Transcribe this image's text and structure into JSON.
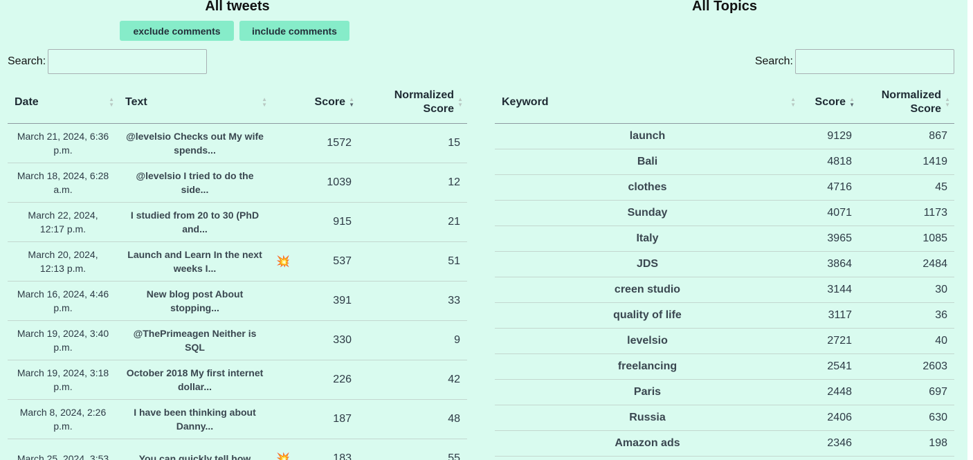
{
  "left": {
    "title": "All tweets",
    "buttons": {
      "exclude": "exclude comments",
      "include": "include comments"
    },
    "search_label": "Search:",
    "columns": {
      "date": "Date",
      "text": "Text",
      "score": "Score",
      "norm1": "Normalized",
      "norm2": "Score"
    },
    "rows": [
      {
        "date": "March 21, 2024, 6:36 p.m.",
        "text": "@levelsio Checks out My wife spends...",
        "flag": "",
        "score": "1572",
        "norm": "15"
      },
      {
        "date": "March 18, 2024, 6:28 a.m.",
        "text": "@levelsio I tried to do the side...",
        "flag": "",
        "score": "1039",
        "norm": "12"
      },
      {
        "date": "March 22, 2024, 12:17 p.m.",
        "text": "I studied from 20 to 30 (PhD and...",
        "flag": "",
        "score": "915",
        "norm": "21"
      },
      {
        "date": "March 20, 2024, 12:13 p.m.",
        "text": "Launch and Learn In the next weeks I...",
        "flag": "💥",
        "score": "537",
        "norm": "51"
      },
      {
        "date": "March 16, 2024, 4:46 p.m.",
        "text": "New blog post About stopping...",
        "flag": "",
        "score": "391",
        "norm": "33"
      },
      {
        "date": "March 19, 2024, 3:40 p.m.",
        "text": "@ThePrimeagen Neither is SQL",
        "flag": "",
        "score": "330",
        "norm": "9"
      },
      {
        "date": "March 19, 2024, 3:18 p.m.",
        "text": "October 2018 My first internet dollar...",
        "flag": "",
        "score": "226",
        "norm": "42"
      },
      {
        "date": "March 8, 2024, 2:26 p.m.",
        "text": "I have been thinking about Danny...",
        "flag": "",
        "score": "187",
        "norm": "48"
      },
      {
        "date": "March 25, 2024, 3:53",
        "text": "You can quickly tell how",
        "flag": "💥",
        "score": "183",
        "norm": "55"
      }
    ]
  },
  "right": {
    "title": "All Topics",
    "search_label": "Search:",
    "columns": {
      "keyword": "Keyword",
      "score": "Score",
      "norm1": "Normalized",
      "norm2": "Score"
    },
    "rows": [
      {
        "keyword": "launch",
        "score": "9129",
        "norm": "867"
      },
      {
        "keyword": "Bali",
        "score": "4818",
        "norm": "1419"
      },
      {
        "keyword": "clothes",
        "score": "4716",
        "norm": "45"
      },
      {
        "keyword": "Sunday",
        "score": "4071",
        "norm": "1173"
      },
      {
        "keyword": "Italy",
        "score": "3965",
        "norm": "1085"
      },
      {
        "keyword": "JDS",
        "score": "3864",
        "norm": "2484"
      },
      {
        "keyword": "creen studio",
        "score": "3144",
        "norm": "30"
      },
      {
        "keyword": "quality of life",
        "score": "3117",
        "norm": "36"
      },
      {
        "keyword": "levelsio",
        "score": "2721",
        "norm": "40"
      },
      {
        "keyword": "freelancing",
        "score": "2541",
        "norm": "2603"
      },
      {
        "keyword": "Paris",
        "score": "2448",
        "norm": "697"
      },
      {
        "keyword": "Russia",
        "score": "2406",
        "norm": "630"
      },
      {
        "keyword": "Amazon ads",
        "score": "2346",
        "norm": "198"
      }
    ]
  }
}
